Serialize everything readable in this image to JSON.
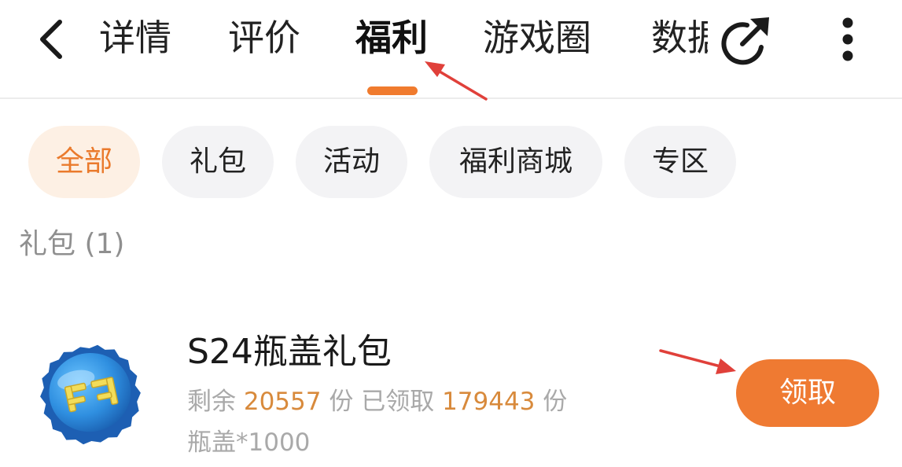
{
  "nav": {
    "tabs": [
      {
        "label": "详情"
      },
      {
        "label": "评价"
      },
      {
        "label": "福利"
      },
      {
        "label": "游戏圈"
      },
      {
        "label": "数据"
      }
    ],
    "active_tab": "福利",
    "back_icon": "chevron-left-icon",
    "share_icon": "share-icon",
    "more_icon": "more-vertical-icon"
  },
  "filters": {
    "chips": [
      {
        "label": "全部"
      },
      {
        "label": "礼包"
      },
      {
        "label": "活动"
      },
      {
        "label": "福利商城"
      },
      {
        "label": "专区"
      }
    ],
    "active_chip": "全部"
  },
  "section": {
    "label": "礼包 (1)"
  },
  "gift": {
    "icon": "bottle-cap-icon",
    "name": "S24瓶盖礼包",
    "remaining_label": "剩余",
    "remaining_value": "20557",
    "remaining_unit": "份",
    "claimed_label": "已领取",
    "claimed_value": "179443",
    "claimed_unit": "份",
    "cost": "瓶盖*1000",
    "claim_button": "领取"
  },
  "colors": {
    "accent": "#ef7a32",
    "annotation_arrow": "#e0403a",
    "chip_active_bg": "#fdf0e4",
    "chip_bg": "#f3f3f5"
  }
}
